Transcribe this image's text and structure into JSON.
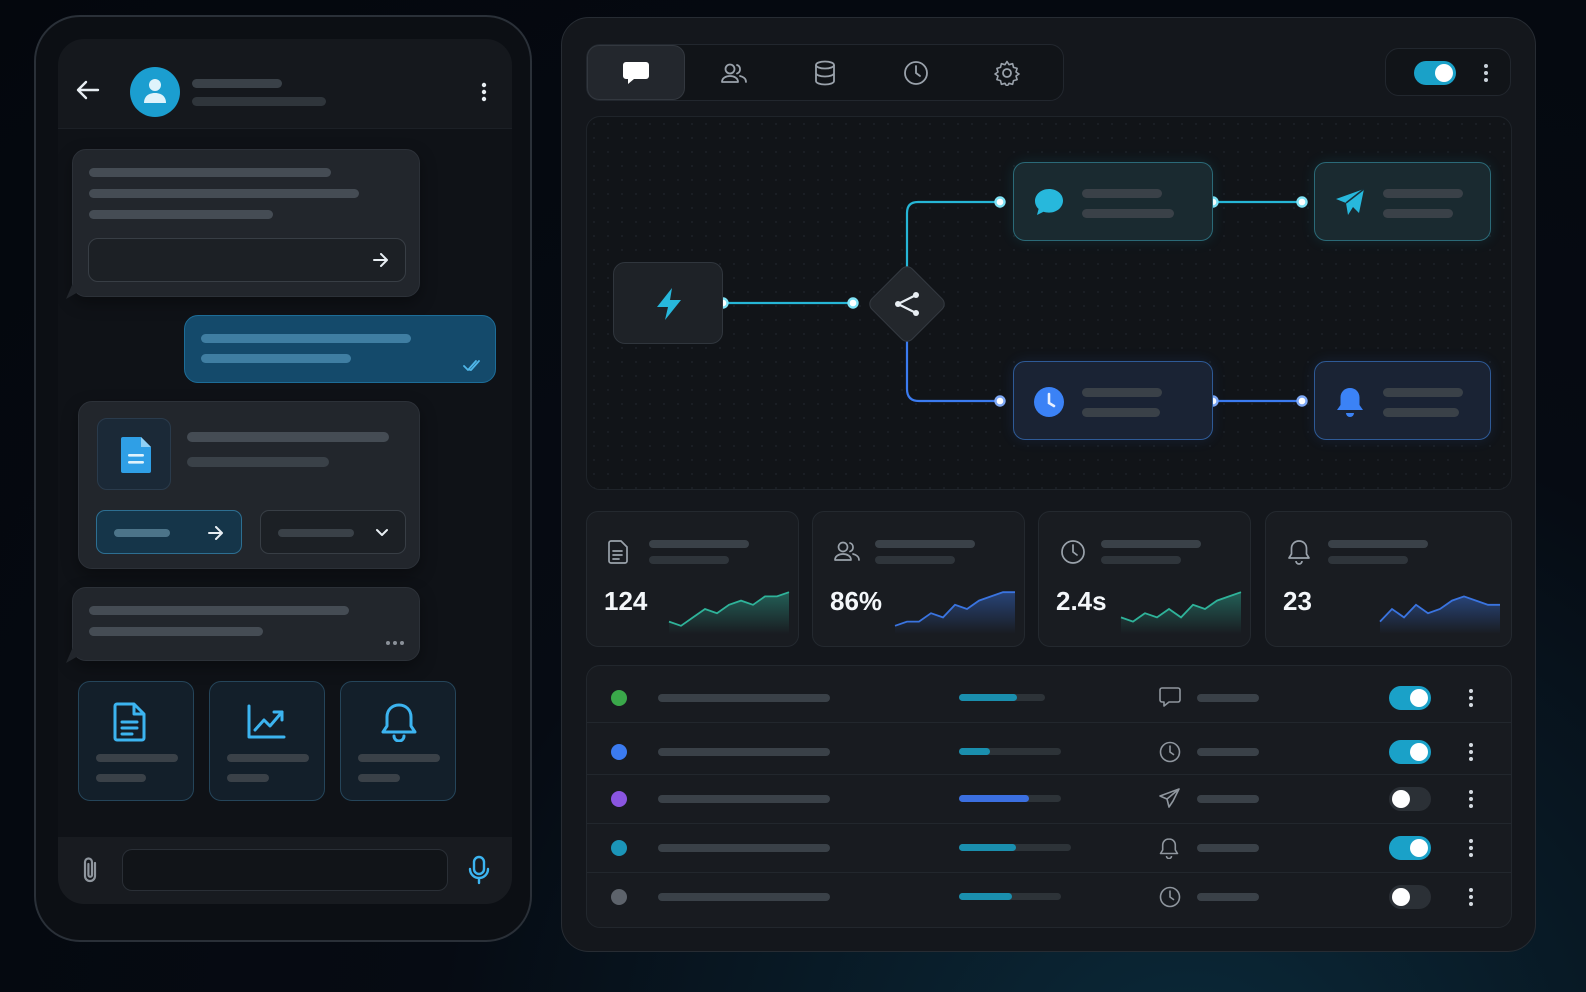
{
  "colors": {
    "accent": "#1aa1c8",
    "accent_blue": "#3b82f6",
    "panel": "#14171c",
    "status_green": "#3aa84a",
    "status_blue": "#3b7bf0",
    "status_purple": "#8a55e0",
    "status_teal": "#1b95b8",
    "status_gray": "#5d636b"
  },
  "phone": {
    "header": {
      "back_icon": "arrow-left-icon",
      "avatar_icon": "user-icon",
      "menu_icon": "kebab-icon"
    },
    "messages": [
      {
        "type": "incoming-with-action",
        "action_icon": "arrow-right-icon"
      },
      {
        "type": "outgoing",
        "status_icon": "double-check-icon"
      },
      {
        "type": "file-card",
        "file_icon": "document-icon",
        "buttons": [
          "arrow-right-icon",
          "chevron-down-icon"
        ]
      },
      {
        "type": "incoming-typing",
        "typing_icon": "ellipsis-icon"
      }
    ],
    "quick_tiles": [
      {
        "icon": "document-icon"
      },
      {
        "icon": "chart-icon"
      },
      {
        "icon": "bell-icon"
      }
    ],
    "composer": {
      "attach_icon": "paperclip-icon",
      "mic_icon": "mic-icon"
    }
  },
  "dashboard": {
    "tabs": [
      {
        "icon": "chat-icon",
        "active": true
      },
      {
        "icon": "users-icon",
        "active": false
      },
      {
        "icon": "database-icon",
        "active": false
      },
      {
        "icon": "clock-icon",
        "active": false
      },
      {
        "icon": "gear-icon",
        "active": false
      }
    ],
    "header_toggle_on": true,
    "flow": {
      "trigger_icon": "lightning-icon",
      "branch_icon": "share-icon",
      "nodes": [
        {
          "icon": "chat-icon"
        },
        {
          "icon": "send-icon"
        },
        {
          "icon": "clock-icon"
        },
        {
          "icon": "bell-icon"
        }
      ]
    },
    "stats": [
      {
        "icon": "document-icon",
        "value": "124",
        "spark": [
          2,
          1,
          3,
          5,
          4,
          6,
          7,
          6,
          8,
          8,
          9
        ],
        "color": "#2fb39a"
      },
      {
        "icon": "users-icon",
        "value": "86%",
        "spark": [
          1,
          2,
          2,
          4,
          3,
          6,
          5,
          7,
          8,
          9,
          9
        ],
        "color": "#3a74e0"
      },
      {
        "icon": "clock-icon",
        "value": "2.4s",
        "spark": [
          3,
          2,
          4,
          3,
          5,
          3,
          6,
          5,
          7,
          8,
          9
        ],
        "color": "#2fb39a"
      },
      {
        "icon": "bell-icon",
        "value": "23",
        "spark": [
          2,
          5,
          3,
          6,
          4,
          5,
          7,
          8,
          7,
          6,
          6
        ],
        "color": "#3a74e0"
      }
    ],
    "rows": [
      {
        "status": "green",
        "progress": 0.68,
        "icon": "chat-icon",
        "enabled": true
      },
      {
        "status": "blue",
        "progress": 0.3,
        "icon": "clock-icon",
        "enabled": true
      },
      {
        "status": "purple",
        "progress": 0.69,
        "icon": "send-icon",
        "enabled": false
      },
      {
        "status": "teal",
        "progress": 0.51,
        "icon": "bell-icon",
        "enabled": true
      },
      {
        "status": "gray",
        "progress": 0.52,
        "icon": "clock-icon",
        "enabled": false
      }
    ]
  }
}
